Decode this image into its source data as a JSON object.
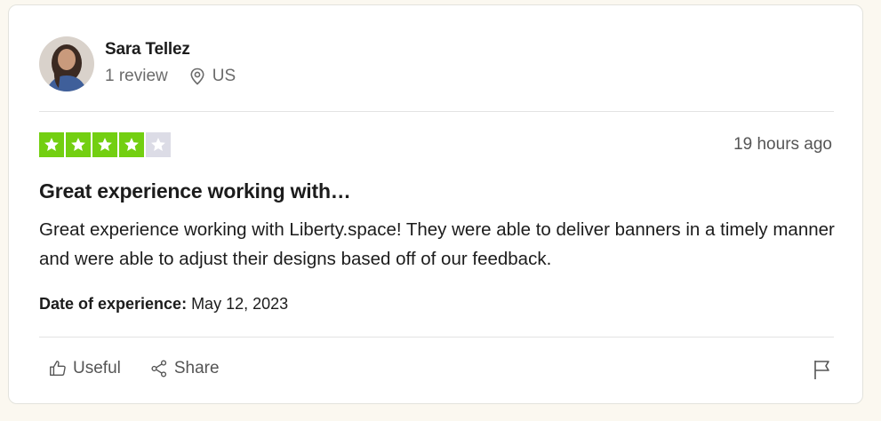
{
  "reviewer": {
    "name": "Sara Tellez",
    "review_count": "1 review",
    "country": "US"
  },
  "review": {
    "rating": 4,
    "max_rating": 5,
    "time_ago": "19 hours ago",
    "title": "Great experience working with…",
    "body": "Great experience working with Liberty.space! They were able to deliver banners in a timely manner and were able to adjust their designs based off of our feedback.",
    "date_label": "Date of experience:",
    "date_value": " May 12, 2023"
  },
  "actions": {
    "useful_label": "Useful",
    "share_label": "Share"
  },
  "colors": {
    "star_filled": "#73cf11",
    "star_empty": "#dcdce6",
    "page_bg": "#fbf8f0"
  }
}
